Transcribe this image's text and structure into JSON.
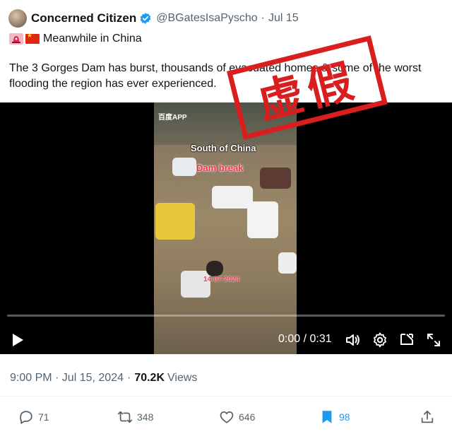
{
  "author": {
    "name": "Concerned Citizen",
    "handle": "@BGatesIsaPyscho",
    "date": "Jul 15"
  },
  "post": {
    "line1": "Meanwhile in China",
    "text": "The 3 Gorges Dam has burst, thousands of evacuated homes & some of the worst flooding the region has ever experienced."
  },
  "video": {
    "app_tag": "百度APP",
    "overlay_location": "South of China",
    "overlay_caption": "Dam break",
    "overlay_date": "14-07-2024",
    "stamp_text": "虚假",
    "time": "0:00 / 0:31",
    "progress": 0.0
  },
  "meta": {
    "timestamp": "9:00 PM · Jul 15, 2024",
    "views_count": "70.2K",
    "views_label": "Views"
  },
  "actions": {
    "replies": "71",
    "reposts": "348",
    "likes": "646",
    "bookmarks": "98"
  },
  "colors": {
    "accent": "#1d9bf0",
    "stamp": "#d81e1e",
    "muted": "#536471"
  },
  "icons": [
    "avatar",
    "verified-badge-icon",
    "siren-icon",
    "china-flag-icon",
    "play-icon",
    "volume-icon",
    "settings-gear-icon",
    "pip-icon",
    "fullscreen-icon",
    "reply-icon",
    "repost-icon",
    "like-icon",
    "bookmark-icon",
    "share-icon"
  ]
}
